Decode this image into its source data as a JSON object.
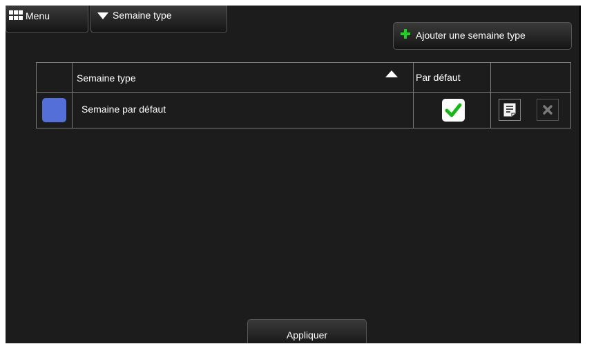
{
  "header": {
    "menu_label": "Menu",
    "semaine_type_label": "Semaine type"
  },
  "toolbar": {
    "add_label": "Ajouter une semaine type",
    "add_icon": "plus-icon",
    "add_icon_color": "#1fd41f"
  },
  "table": {
    "columns": {
      "name": "Semaine type",
      "default": "Par défaut"
    },
    "sort": "ascending",
    "rows": [
      {
        "color": "#5470d8",
        "name": "Semaine par défaut",
        "is_default": true
      }
    ]
  },
  "footer": {
    "apply_label": "Appliquer"
  }
}
